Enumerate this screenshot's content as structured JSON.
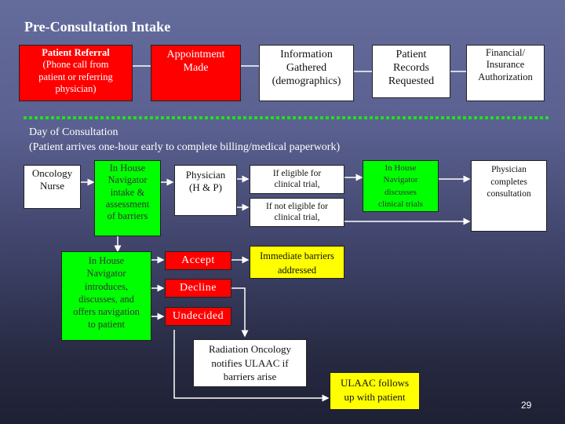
{
  "pre_consultation": {
    "title": "Pre-Consultation Intake",
    "steps": [
      {
        "title": "Patient Referral",
        "lines": [
          "(Phone call from",
          "patient or referring",
          "physician)"
        ]
      },
      {
        "lines": [
          "Appointment",
          "Made"
        ]
      },
      {
        "lines": [
          "Information",
          "Gathered",
          "(demographics)"
        ]
      },
      {
        "lines": [
          "Patient",
          "Records",
          "Requested"
        ]
      },
      {
        "lines": [
          "Financial/",
          "Insurance",
          "Authorization"
        ]
      }
    ]
  },
  "day_of_consultation": {
    "heading": "Day of Consultation",
    "subheading": "(Patient arrives one-hour early to complete billing/medical paperwork)",
    "nodes": {
      "oncology_nurse": [
        "Oncology",
        "Nurse"
      ],
      "navigator_intake": [
        "In House",
        "Navigator",
        "intake &",
        "assessment",
        "of barriers"
      ],
      "physician_hp": [
        "Physician",
        "(H & P)"
      ],
      "eligible": [
        "If eligible for",
        "clinical trial,"
      ],
      "not_eligible": [
        "If not eligible for",
        "clinical trial,"
      ],
      "navigator_trials": [
        "In House",
        "Navigator",
        "discusses",
        "clinical trials"
      ],
      "physician_completes": [
        "Physician",
        "completes",
        "consultation"
      ],
      "navigator_offers": [
        "In House",
        "Navigator",
        "introduces,",
        "discusses, and",
        "offers navigation",
        "to patient"
      ],
      "accept": "Accept",
      "decline": "Decline",
      "undecided": "Undecided",
      "immediate_barriers": [
        "Immediate barriers",
        "addressed"
      ],
      "radiation_oncology": [
        "Radiation Oncology",
        "notifies ULAAC if",
        "barriers arise"
      ],
      "ulaac_follows": [
        "ULAAC follows",
        "up with patient"
      ]
    }
  },
  "page_number": "29",
  "colors": {
    "red": "#ff0000",
    "green": "#00ff00",
    "yellow": "#ffff00",
    "white": "#ffffff",
    "divider": "#22dd22"
  }
}
